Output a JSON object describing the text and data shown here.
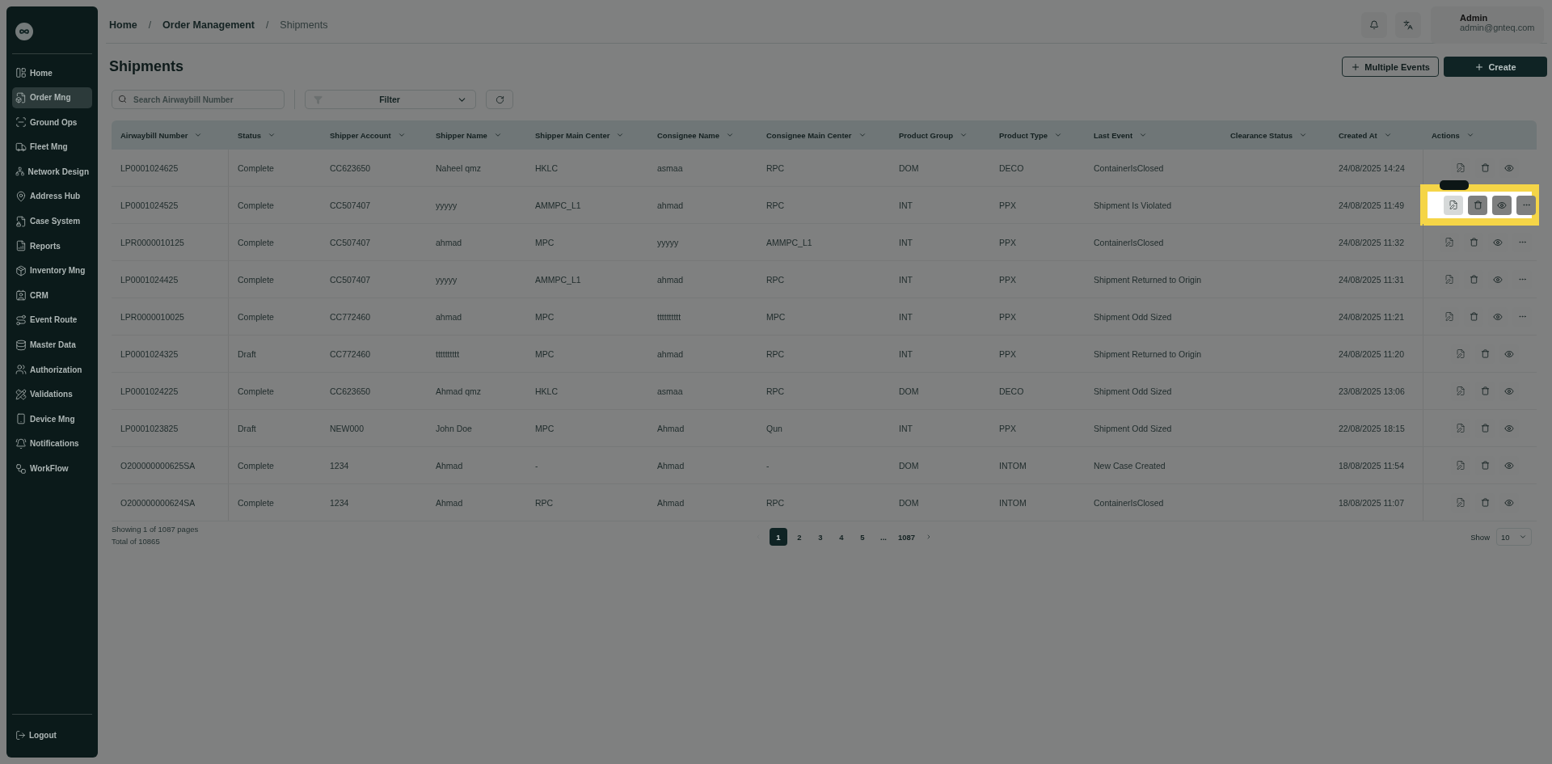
{
  "sidebar": {
    "items": [
      {
        "label": "Home",
        "selected": false
      },
      {
        "label": "Order Mng",
        "selected": true
      },
      {
        "label": "Ground Ops",
        "selected": false
      },
      {
        "label": "Fleet Mng",
        "selected": false
      },
      {
        "label": "Network Design",
        "selected": false
      },
      {
        "label": "Address Hub",
        "selected": false
      },
      {
        "label": "Case System",
        "selected": false
      },
      {
        "label": "Reports",
        "selected": false
      },
      {
        "label": "Inventory Mng",
        "selected": false
      },
      {
        "label": "CRM",
        "selected": false
      },
      {
        "label": "Event Route",
        "selected": false
      },
      {
        "label": "Master Data",
        "selected": false
      },
      {
        "label": "Authorization",
        "selected": false
      },
      {
        "label": "Validations",
        "selected": false
      },
      {
        "label": "Device Mng",
        "selected": false
      },
      {
        "label": "Notifications",
        "selected": false
      },
      {
        "label": "WorkFlow",
        "selected": false
      }
    ],
    "logout": "Logout"
  },
  "breadcrumbs": [
    "Home",
    "Order Management",
    "Shipments"
  ],
  "breadcrumb_separator": "/",
  "user": {
    "name": "Admin",
    "email": "admin@gnteq.com"
  },
  "page_title": "Shipments",
  "buttons": {
    "multiple_events": "Multiple Events",
    "create": "Create"
  },
  "search": {
    "placeholder": "Search Airwaybill Number"
  },
  "filter": {
    "label": "Filter"
  },
  "table": {
    "columns": [
      "Airwaybill Number",
      "Status",
      "Shipper Account",
      "Shipper Name",
      "Shipper Main Center",
      "Consignee Name",
      "Consignee Main Center",
      "Product Group",
      "Product Type",
      "Last Event",
      "Clearance Status",
      "Created At",
      "Actions"
    ],
    "rows": [
      {
        "cells": [
          "LP0001024625",
          "Complete",
          "CC623650",
          "Naheel qmz",
          "HKLC",
          "asmaa",
          "RPC",
          "DOM",
          "DECO",
          "ContainerIsClosed",
          "",
          "24/08/2025 14:24"
        ],
        "more_actions": false,
        "highlighted": false
      },
      {
        "cells": [
          "LP0001024525",
          "Complete",
          "CC507407",
          "yyyyy",
          "AMMPC_L1",
          "ahmad",
          "RPC",
          "INT",
          "PPX",
          "Shipment Is Violated",
          "",
          "24/08/2025 11:49"
        ],
        "more_actions": true,
        "highlighted": true
      },
      {
        "cells": [
          "LPR0000010125",
          "Complete",
          "CC507407",
          "ahmad",
          "MPC",
          "yyyyy",
          "AMMPC_L1",
          "INT",
          "PPX",
          "ContainerIsClosed",
          "",
          "24/08/2025 11:32"
        ],
        "more_actions": true,
        "highlighted": false
      },
      {
        "cells": [
          "LP0001024425",
          "Complete",
          "CC507407",
          "yyyyy",
          "AMMPC_L1",
          "ahmad",
          "RPC",
          "INT",
          "PPX",
          "Shipment Returned to Origin",
          "",
          "24/08/2025 11:31"
        ],
        "more_actions": true,
        "highlighted": false
      },
      {
        "cells": [
          "LPR0000010025",
          "Complete",
          "CC772460",
          "ahmad",
          "MPC",
          "tttttttttt",
          "MPC",
          "INT",
          "PPX",
          "Shipment Odd Sized",
          "",
          "24/08/2025 11:21"
        ],
        "more_actions": true,
        "highlighted": false
      },
      {
        "cells": [
          "LP0001024325",
          "Draft",
          "CC772460",
          "tttttttttt",
          "MPC",
          "ahmad",
          "RPC",
          "INT",
          "PPX",
          "Shipment Returned to Origin",
          "",
          "24/08/2025 11:20"
        ],
        "more_actions": false,
        "highlighted": false
      },
      {
        "cells": [
          "LP0001024225",
          "Complete",
          "CC623650",
          "Ahmad qmz",
          "HKLC",
          "asmaa",
          "RPC",
          "DOM",
          "DECO",
          "Shipment Odd Sized",
          "",
          "23/08/2025 13:06"
        ],
        "more_actions": false,
        "highlighted": false
      },
      {
        "cells": [
          "LP0001023825",
          "Draft",
          "NEW000",
          "John Doe",
          "MPC",
          "Ahmad",
          "Qun",
          "INT",
          "PPX",
          "Shipment Odd Sized",
          "",
          "22/08/2025 18:15"
        ],
        "more_actions": false,
        "highlighted": false
      },
      {
        "cells": [
          "O200000000625SA",
          "Complete",
          "1234",
          "Ahmad",
          "-",
          "Ahmad",
          "-",
          "DOM",
          "INTOM",
          "New Case Created",
          "",
          "18/08/2025 11:54"
        ],
        "more_actions": false,
        "highlighted": false
      },
      {
        "cells": [
          "O200000000624SA",
          "Complete",
          "1234",
          "Ahmad",
          "RPC",
          "Ahmad",
          "RPC",
          "DOM",
          "INTOM",
          "ContainerIsClosed",
          "",
          "18/08/2025 11:07"
        ],
        "more_actions": false,
        "highlighted": false
      }
    ]
  },
  "footer": {
    "showing": "Showing 1 of 1087 pages",
    "total": "Total of 10865",
    "pages": [
      {
        "label": "1",
        "selected": true
      },
      {
        "label": "2",
        "selected": false
      },
      {
        "label": "3",
        "selected": false
      },
      {
        "label": "4",
        "selected": false
      },
      {
        "label": "5",
        "selected": false
      },
      {
        "label": "...",
        "selected": false
      },
      {
        "label": "1087",
        "selected": false
      }
    ],
    "show_label": "Show",
    "page_size": "10"
  }
}
